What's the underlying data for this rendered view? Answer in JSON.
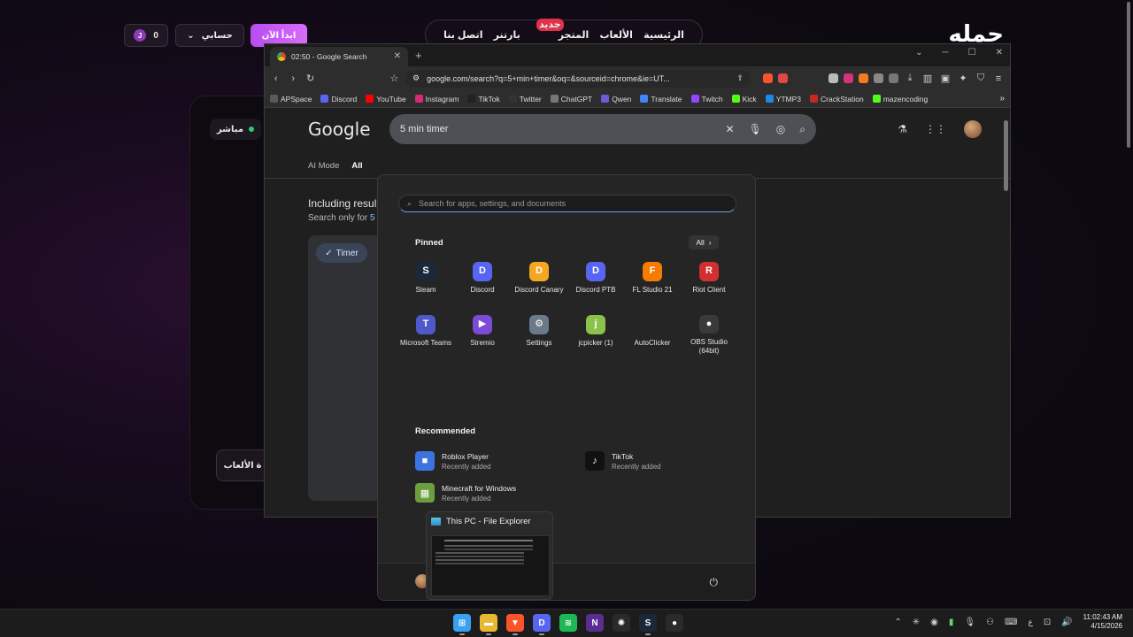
{
  "site": {
    "logo": "حمله",
    "nav": [
      {
        "label": "الرئيسية"
      },
      {
        "label": "الألعاب"
      },
      {
        "label": "المتجر",
        "badge": "جديد"
      },
      {
        "label": "بارتنر"
      },
      {
        "label": "اتصل بنا"
      }
    ],
    "start_now": "ابدأ الآن",
    "account": "حسابي",
    "coins_value": "0",
    "coins_icon_letter": "J",
    "live_label": "مباشر",
    "games_label": "ة الألعاب"
  },
  "chrome": {
    "tab_title": "02:50 - Google Search",
    "url": "google.com/search?q=5+min+timer&oq=&sourceid=chrome&ie=UT...",
    "bookmarks": [
      {
        "label": "APSpace",
        "color": "#5a5a5a"
      },
      {
        "label": "Discord",
        "color": "#5865f2"
      },
      {
        "label": "YouTube",
        "color": "#ff0000"
      },
      {
        "label": "Instagram",
        "color": "#d62976"
      },
      {
        "label": "TikTok",
        "color": "#222222"
      },
      {
        "label": "Twitter",
        "color": "#333333"
      },
      {
        "label": "ChatGPT",
        "color": "#777777"
      },
      {
        "label": "Qwen",
        "color": "#6b5cd6"
      },
      {
        "label": "Translate",
        "color": "#4285f4"
      },
      {
        "label": "Twitch",
        "color": "#9146ff"
      },
      {
        "label": "Kick",
        "color": "#53fc18"
      },
      {
        "label": "YTMP3",
        "color": "#1e88e5"
      },
      {
        "label": "CrackStation",
        "color": "#c62828"
      },
      {
        "label": "mazencoding",
        "color": "#53fc18"
      }
    ]
  },
  "google": {
    "logo": "Google",
    "query": "5 min timer",
    "tabs": [
      "AI Mode",
      "All"
    ],
    "including": "Including resul",
    "search_only_prefix": "Search only for ",
    "search_only_link": "5",
    "timer_chip": "Timer"
  },
  "start_menu": {
    "search_placeholder": "Search for apps, settings, and documents",
    "pinned_title": "Pinned",
    "all_label": "All",
    "pinned": [
      {
        "name": "Steam",
        "icon": "steam-icon",
        "color": "#1b2838",
        "glyph": "S"
      },
      {
        "name": "Discord",
        "icon": "discord-icon",
        "color": "#5865f2",
        "glyph": "D"
      },
      {
        "name": "Discord Canary",
        "icon": "discord-canary-icon",
        "color": "#f5a623",
        "glyph": "D"
      },
      {
        "name": "Discord PTB",
        "icon": "discord-ptb-icon",
        "color": "#5865f2",
        "glyph": "D"
      },
      {
        "name": "FL Studio 21",
        "icon": "fl-studio-icon",
        "color": "#f57c00",
        "glyph": "F"
      },
      {
        "name": "Riot Client",
        "icon": "riot-client-icon",
        "color": "#d32f2f",
        "glyph": "R"
      },
      {
        "name": "Microsoft Teams",
        "icon": "teams-icon",
        "color": "#5059c9",
        "glyph": "T"
      },
      {
        "name": "Stremio",
        "icon": "stremio-icon",
        "color": "#7b4bd6",
        "glyph": "▶"
      },
      {
        "name": "Settings",
        "icon": "settings-gear-icon",
        "color": "#6a7a8a",
        "glyph": "⚙"
      },
      {
        "name": "jcpicker (1)",
        "icon": "jcpicker-icon",
        "color": "#8bc34a",
        "glyph": "j"
      },
      {
        "name": "AutoClicker",
        "icon": "autoclicker-icon",
        "color": "#252525",
        "glyph": ""
      },
      {
        "name": "OBS Studio (64bit)",
        "icon": "obs-icon",
        "color": "#3a3a3a",
        "glyph": "●"
      }
    ],
    "recommended_title": "Recommended",
    "recommended": [
      {
        "name": "Roblox Player",
        "sub": "Recently added",
        "icon": "roblox-icon",
        "color": "#3b74e0",
        "glyph": "■"
      },
      {
        "name": "TikTok",
        "sub": "Recently added",
        "icon": "tiktok-icon",
        "color": "#111111",
        "glyph": "♪"
      },
      {
        "name": "Minecraft for Windows",
        "sub": "Recently added",
        "icon": "minecraft-icon",
        "color": "#6d9e3e",
        "glyph": "▦"
      }
    ]
  },
  "file_explorer_preview": {
    "title": "This PC - File Explorer"
  },
  "taskbar": {
    "apps": [
      {
        "name": "windows-start",
        "color": "#3aa0f0",
        "glyph": "⊞"
      },
      {
        "name": "file-explorer",
        "color": "#e8b830",
        "glyph": "▬"
      },
      {
        "name": "brave",
        "color": "#fb542b",
        "glyph": "▼"
      },
      {
        "name": "discord",
        "color": "#5865f2",
        "glyph": "D"
      },
      {
        "name": "spotify",
        "color": "#1db954",
        "glyph": "≋"
      },
      {
        "name": "nzxt",
        "color": "#5c2d91",
        "glyph": "N"
      },
      {
        "name": "steelseries",
        "color": "#2a2a2a",
        "glyph": "✺"
      },
      {
        "name": "steam",
        "color": "#1b2838",
        "glyph": "S"
      },
      {
        "name": "obs",
        "color": "#2a2a2a",
        "glyph": "●"
      }
    ],
    "lang": "ع",
    "time": "11:02:43 AM",
    "date": "4/15/2026"
  }
}
